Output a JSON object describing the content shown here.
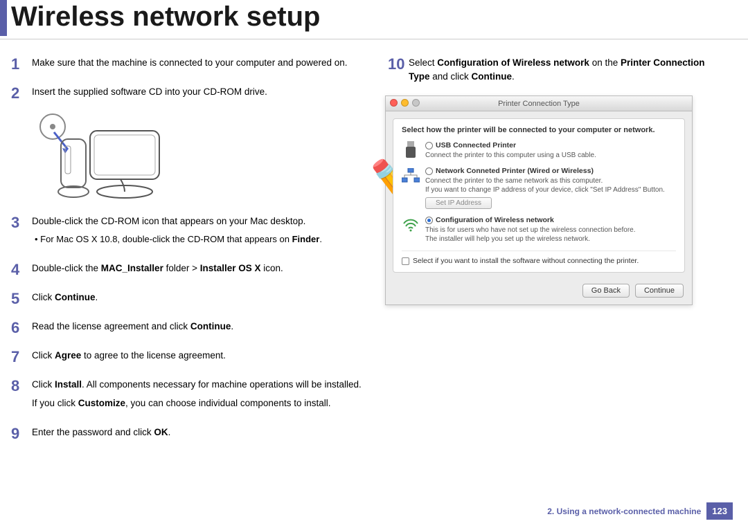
{
  "header": {
    "title": "Wireless network setup"
  },
  "steps_left": [
    {
      "n": "1",
      "text": "Make sure that the machine is connected to your computer and powered on."
    },
    {
      "n": "2",
      "text": "Insert the supplied software CD into your CD-ROM drive."
    },
    {
      "n": "3",
      "text": "Double-click the CD-ROM icon that appears on your Mac desktop.",
      "sub": "For Mac OS X 10.8, double-click the CD-ROM that appears on <b>Finder</b>."
    },
    {
      "n": "4",
      "html": "Double-click the <b>MAC_Installer</b> folder > <b>Installer OS X</b> icon."
    },
    {
      "n": "5",
      "html": "Click <b>Continue</b>."
    },
    {
      "n": "6",
      "html": "Read the license agreement and click <b>Continue</b>."
    },
    {
      "n": "7",
      "html": "Click <b>Agree</b> to agree to the license agreement."
    },
    {
      "n": "8",
      "html": "Click <b>Install</b>. All components necessary for machine operations will be installed.",
      "extra": "If you click <b>Customize</b>, you can choose individual components to install."
    },
    {
      "n": "9",
      "html": "Enter the password and click <b>OK</b>."
    }
  ],
  "step10": {
    "n": "10",
    "html": "Select <b>Configuration of Wireless network</b> on the <b>Printer Connection Type</b> and click <b>Continue</b>."
  },
  "dialog": {
    "title": "Printer Connection Type",
    "prompt": "Select how the printer will be connected to your computer or network.",
    "opt1": {
      "title": "USB Connected Printer",
      "desc": "Connect the printer to this computer using a USB cable."
    },
    "opt2": {
      "title": "Network Conneted Printer (Wired or Wireless)",
      "desc": "Connect the printer to the same network as this computer.\nIf you want to change IP address of your device, click \"Set IP Address\" Button.",
      "button": "Set IP Address"
    },
    "opt3": {
      "title": "Configuration of Wireless network",
      "desc": "This is for users who have not set up the wireless connection before.\nThe installer will help you set up the wireless network."
    },
    "checkbox": "Select if you want to install the software without connecting the printer.",
    "back": "Go Back",
    "cont": "Continue"
  },
  "footer": {
    "chapter": "2.  Using a network-connected machine",
    "page": "123"
  }
}
